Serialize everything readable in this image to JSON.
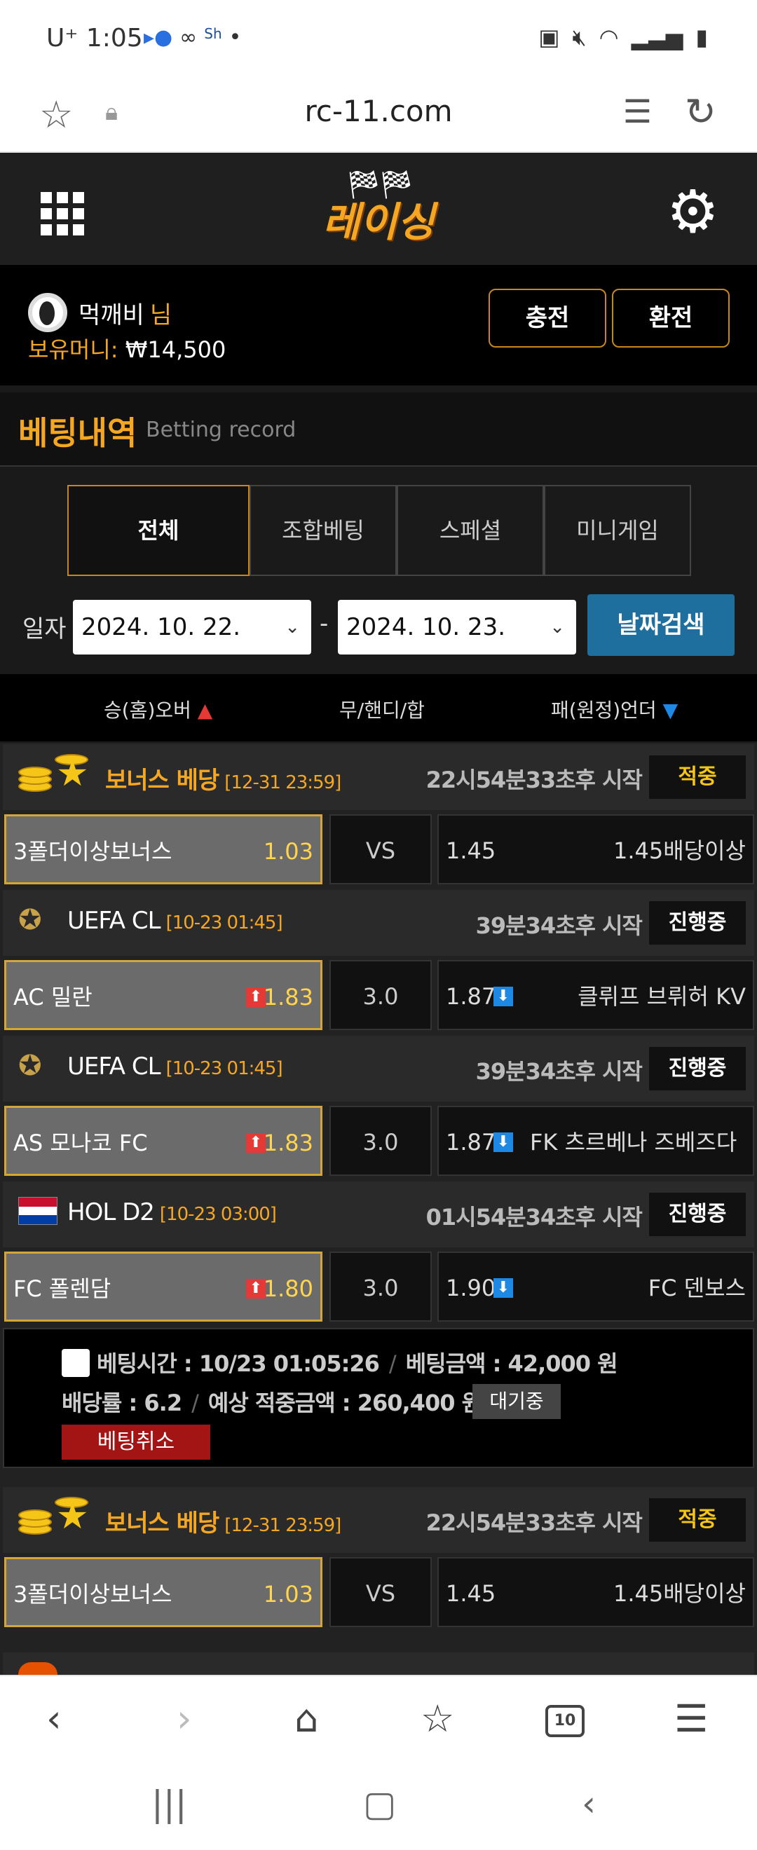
{
  "status_bar": {
    "time": "1:05",
    "carrier": "U⁺",
    "left_icons": [
      "▸●",
      "∞",
      "Sh",
      "•"
    ],
    "right_icons": [
      "battery-saver-icon",
      "mute-icon",
      "wifi-icon",
      "signal-icon",
      "battery-icon"
    ]
  },
  "browser": {
    "url": "rc-11.com"
  },
  "header": {
    "brand": "레이싱"
  },
  "user": {
    "name": "먹깨비",
    "honorific": "님",
    "money_label": "보유머니: ",
    "money_value": "₩14,500",
    "charge_label": "충전",
    "exchange_label": "환전"
  },
  "title": {
    "ko": "베팅내역",
    "en": "Betting record"
  },
  "tabs": [
    {
      "label": "전체",
      "active": true
    },
    {
      "label": "조합베팅",
      "active": false
    },
    {
      "label": "스페셜",
      "active": false
    },
    {
      "label": "미니게임",
      "active": false
    }
  ],
  "date_filter": {
    "label": "일자",
    "from": "2024. 10. 22.",
    "separator": "-",
    "to": "2024. 10. 23.",
    "search_label": "날짜검색"
  },
  "columns": {
    "home": "승(홈)오버",
    "draw": "무/핸디/합",
    "away": "패(원정)언더"
  },
  "games": [
    {
      "league": "보너스 베당",
      "time": "[12-31 23:59]",
      "countdown": "22시54분33초후 시작",
      "status": "적중",
      "home": "3폴더이상보너스",
      "home_odd": "1.03",
      "mid": "VS",
      "away_odd": "1.45",
      "away": "1.45배당이상"
    },
    {
      "league": "UEFA CL",
      "time": "[10-23 01:45]",
      "countdown": "39분34초후 시작",
      "status": "진행중",
      "home": "AC 밀란",
      "home_odd": "1.83",
      "mid": "3.0",
      "away_odd": "1.87",
      "away": "클뤼프 브뤼허 KV"
    },
    {
      "league": "UEFA CL",
      "time": "[10-23 01:45]",
      "countdown": "39분34초후 시작",
      "status": "진행중",
      "home": "AS 모나코 FC",
      "home_odd": "1.83",
      "mid": "3.0",
      "away_odd": "1.87",
      "away": "FK 츠르베나 즈베즈다"
    },
    {
      "league": "HOL D2",
      "time": "[10-23 03:00]",
      "countdown": "01시54분34초후 시작",
      "status": "진행중",
      "home": "FC 폴렌담",
      "home_odd": "1.80",
      "mid": "3.0",
      "away_odd": "1.90",
      "away": "FC 덴보스"
    },
    {
      "league": "보너스 베당",
      "time": "[12-31 23:59]",
      "countdown": "22시54분33초후 시작",
      "status": "적중",
      "home": "3폴더이상보너스",
      "home_odd": "1.03",
      "mid": "VS",
      "away_odd": "1.45",
      "away": "1.45배당이상"
    }
  ],
  "bet_detail": {
    "time_label": "베팅시간 : 10/23 01:05:26",
    "amount_label": "베팅금액 : 42,000 원",
    "odds_label": "배당률 : 6.2",
    "expected_label": "예상 적중금액 : 260,400 원",
    "status": "대기중",
    "cancel_label": "베팅취소"
  },
  "bottom_nav": {
    "tabs_count": "10"
  },
  "colors": {
    "accent": "#f5a623",
    "border_gold": "#d4a537",
    "search_button": "#1e6e9e",
    "cancel_button": "#a31515",
    "odd_up": "#e53935",
    "odd_down": "#1e88e5"
  }
}
